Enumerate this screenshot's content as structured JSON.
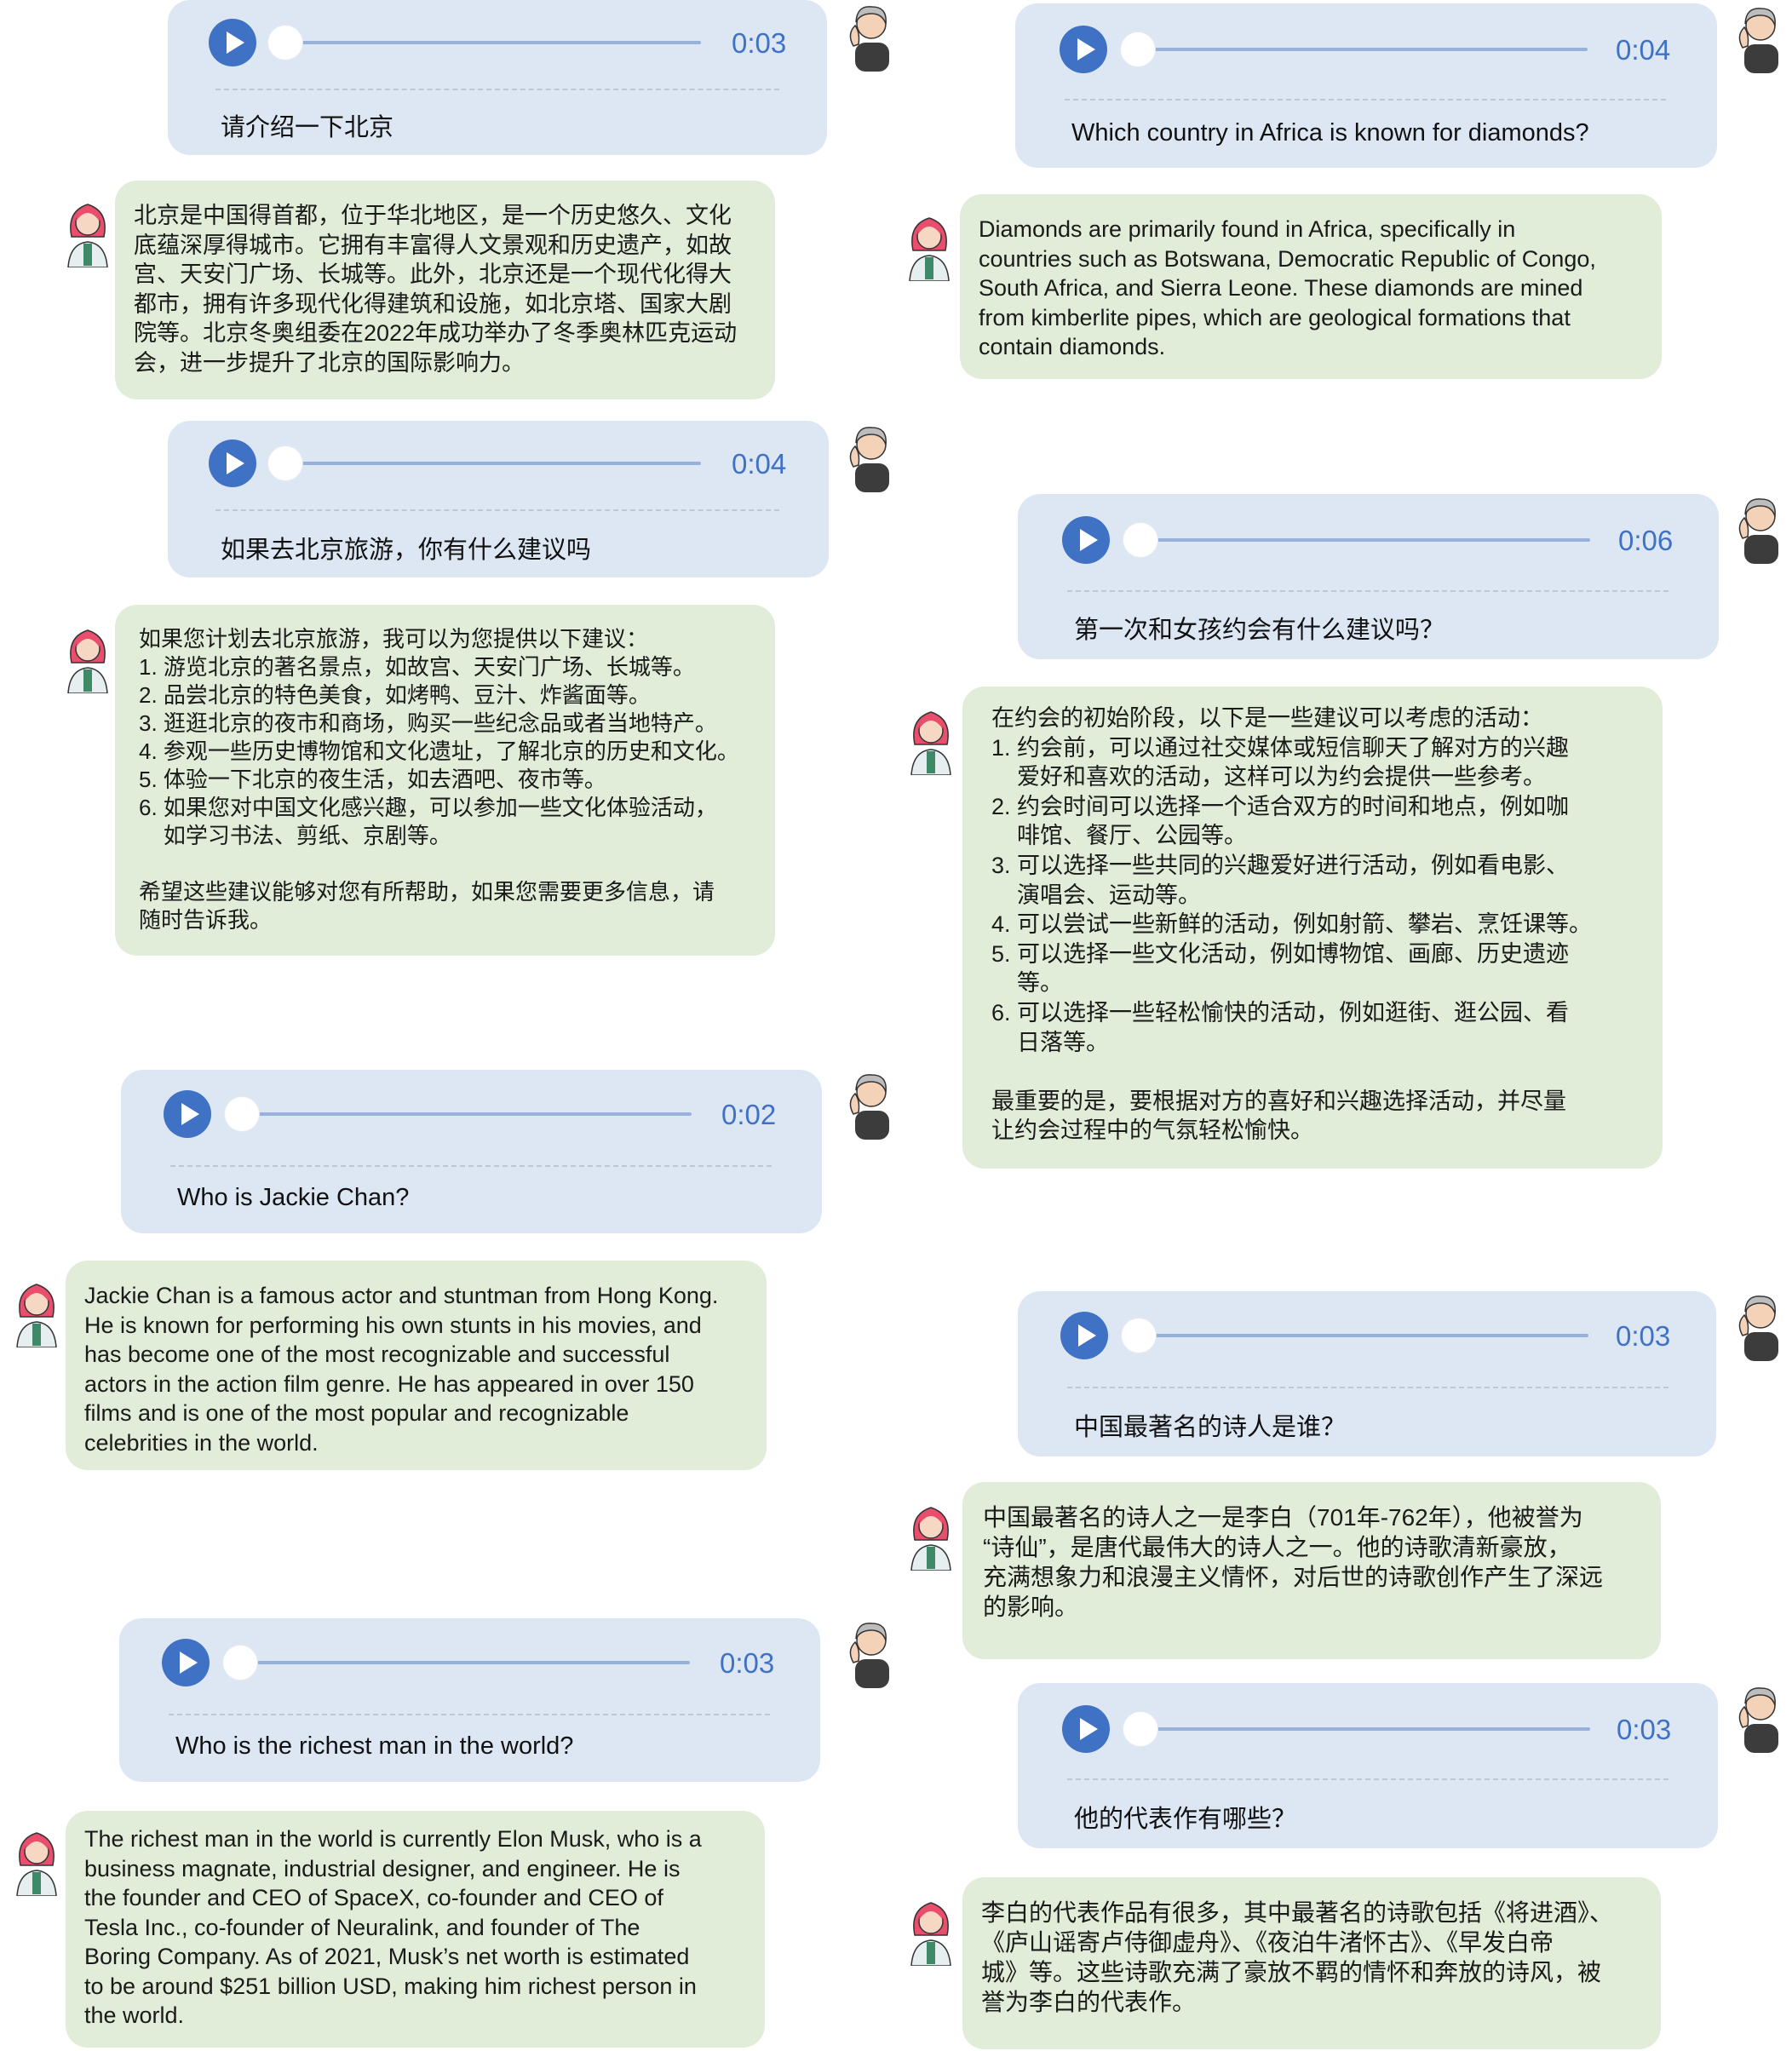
{
  "voice_messages": [
    {
      "duration": "0:03",
      "text": "请介绍一下北京"
    },
    {
      "duration": "0:04",
      "text": "如果去北京旅游，你有什么建议吗"
    },
    {
      "duration": "0:02",
      "text": "Who is Jackie Chan?"
    },
    {
      "duration": "0:03",
      "text": "Who is the richest man in the world?"
    },
    {
      "duration": "0:04",
      "text": "Which country in Africa is known for diamonds?"
    },
    {
      "duration": "0:06",
      "text": "第一次和女孩约会有什么建议吗？"
    },
    {
      "duration": "0:03",
      "text": "中国最著名的诗人是谁？"
    },
    {
      "duration": "0:03",
      "text": "他的代表作有哪些？"
    }
  ],
  "replies": [
    {
      "text": "北京是中国得首都，位于华北地区，是一个历史悠久、文化\n底蕴深厚得城市。它拥有丰富得人文景观和历史遗产，如故\n宫、天安门广场、长城等。此外，北京还是一个现代化得大\n都市，拥有许多现代化得建筑和设施，如北京塔、国家大剧\n院等。北京冬奥组委在2022年成功举办了冬季奥林匹克运动\n会，进一步提升了北京的国际影响力。"
    },
    {
      "text": "如果您计划去北京旅游，我可以为您提供以下建议：\n1. 游览北京的著名景点，如故宫、天安门广场、长城等。\n2. 品尝北京的特色美食，如烤鸭、豆汁、炸酱面等。\n3. 逛逛北京的夜市和商场，购买一些纪念品或者当地特产。\n4. 参观一些历史博物馆和文化遗址，了解北京的历史和文化。\n5. 体验一下北京的夜生活，如去酒吧、夜市等。\n6. 如果您对中国文化感兴趣，可以参加一些文化体验活动，\n    如学习书法、剪纸、京剧等。\n\n希望这些建议能够对您有所帮助，如果您需要更多信息，请\n随时告诉我。"
    },
    {
      "text": "Jackie Chan is a famous actor and stuntman from Hong Kong.\nHe is known for performing his own stunts in his movies, and\nhas become one of the most recognizable and successful\nactors in the action film genre. He has appeared in over 150\nfilms and is one of the most popular and recognizable\ncelebrities in the world."
    },
    {
      "text": "The richest man in the world is currently Elon Musk, who is a\nbusiness magnate, industrial designer, and engineer. He is\nthe founder and CEO of SpaceX, co-founder and CEO of\nTesla Inc., co-founder of Neuralink, and founder of The\nBoring Company. As of 2021, Musk’s net worth is estimated\nto be around $251 billion USD, making him richest person in\nthe world."
    },
    {
      "text": "Diamonds are primarily found in Africa, specifically in\ncountries such as Botswana, Democratic Republic of Congo,\nSouth Africa, and Sierra Leone. These diamonds are mined\nfrom kimberlite pipes, which are geological formations that\ncontain diamonds."
    },
    {
      "text": "在约会的初始阶段，以下是一些建议可以考虑的活动：\n1. 约会前，可以通过社交媒体或短信聊天了解对方的兴趣\n    爱好和喜欢的活动，这样可以为约会提供一些参考。\n2. 约会时间可以选择一个适合双方的时间和地点，例如咖\n    啡馆、餐厅、公园等。\n3. 可以选择一些共同的兴趣爱好进行活动，例如看电影、\n    演唱会、运动等。\n4. 可以尝试一些新鲜的活动，例如射箭、攀岩、烹饪课等。\n5. 可以选择一些文化活动，例如博物馆、画廊、历史遗迹\n    等。\n6. 可以选择一些轻松愉快的活动，例如逛街、逛公园、看\n    日落等。\n\n最重要的是，要根据对方的喜好和兴趣选择活动，并尽量\n让约会过程中的气氛轻松愉快。"
    },
    {
      "text": "中国最著名的诗人之一是李白（701年-762年），他被誉为\n“诗仙”，是唐代最伟大的诗人之一。他的诗歌清新豪放，\n充满想象力和浪漫主义情怀，对后世的诗歌创作产生了深远\n的影响。"
    },
    {
      "text": "李白的代表作品有很多，其中最著名的诗歌包括《将进酒》、\n《庐山谣寄卢侍御虚舟》、《夜泊牛渚怀古》、《早发白帝\n城》等。这些诗歌充满了豪放不羁的情怀和奔放的诗风，被\n誉为李白的代表作。"
    }
  ],
  "icons": {
    "play": "play-icon",
    "user": "user-avatar-icon",
    "assistant": "assistant-avatar-icon"
  },
  "colors": {
    "voice_bubble": "#dde7f4",
    "reply_bubble": "#e1edd8",
    "accent": "#3f72c4",
    "track": "#97b1d8"
  }
}
